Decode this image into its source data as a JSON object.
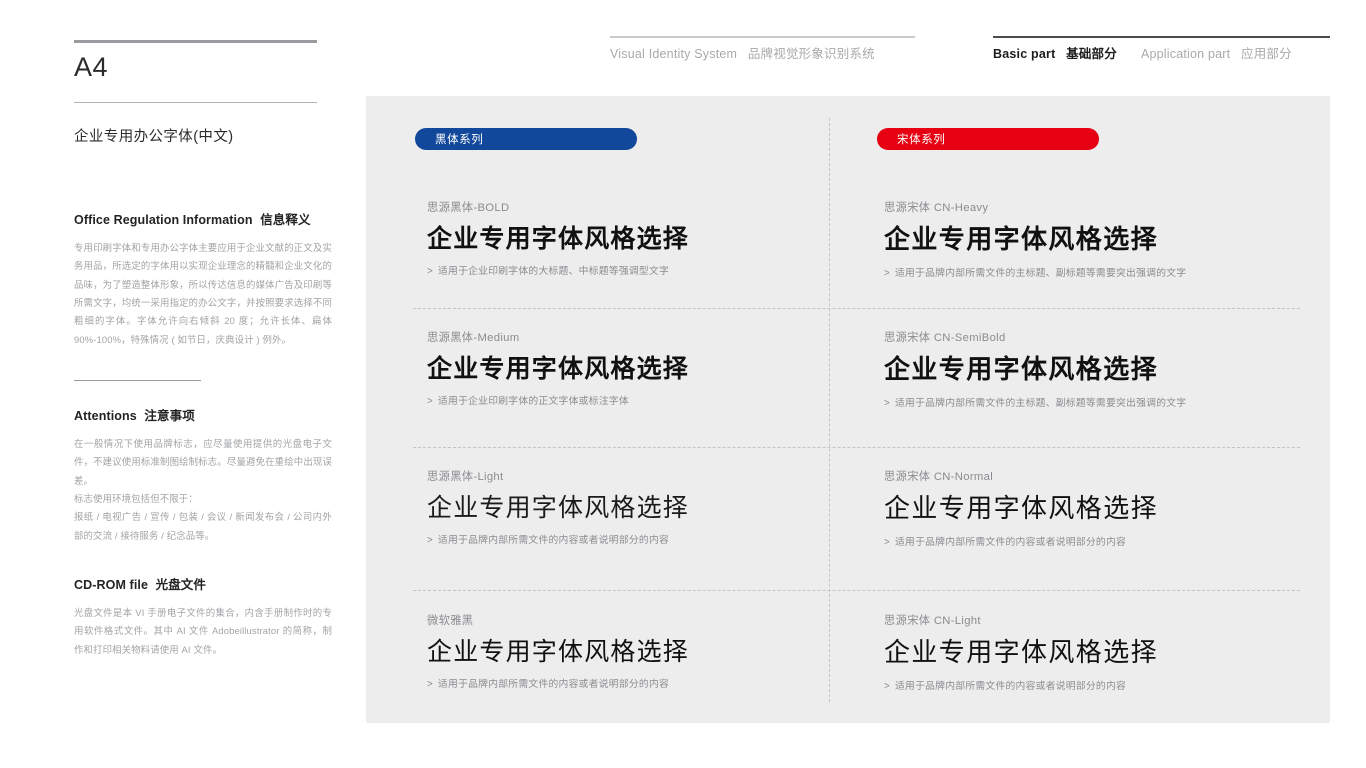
{
  "header": {
    "nav_left": {
      "en": "Visual Identity System",
      "cn": "品牌视觉形象识别系统"
    },
    "nav_right_active": {
      "en": "Basic part",
      "cn": "基础部分"
    },
    "nav_right_inactive": {
      "en": "Application part",
      "cn": "应用部分"
    },
    "active_accent": "#1c1c1c",
    "inactive_accent": "#a8a9ac"
  },
  "sidebar": {
    "page_code": "A4",
    "page_subtitle": "企业专用办公字体(中文)",
    "blocks": [
      {
        "head_en": "Office Regulation Information",
        "head_cn": "信息释义",
        "body": "专用印刷字体和专用办公字体主要应用于企业文献的正文及实务用品，所选定的字体用以实现企业理念的精髓和企业文化的品味，为了塑造整体形象，所以传达信息的媒体广告及印刷等所需文字，均统一采用指定的办公文字，并按照要求选择不同粗细的字体。字体允许向右倾斜 20 度；允许长体、扁体 90%-100%，特殊情况 ( 如节日，庆典设计 ) 例外。"
      },
      {
        "head_en": "Attentions",
        "head_cn": "注意事项",
        "body_1": "在一般情况下使用品牌标志，应尽量使用提供的光盘电子文件，不建议使用标准制图绘制标志。尽量避免在重绘中出现误差。",
        "body_2": "标志使用环境包括但不限于：",
        "body_3": "报纸 / 电视广告 / 宣传 / 包装 / 会议 / 新闻发布会 / 公司内外部的交流 / 接待服务 / 纪念品等。"
      },
      {
        "head_en": "CD-ROM file",
        "head_cn": "光盘文件",
        "body": "光盘文件是本 VI 手册电子文件的集合，内含手册制作时的专用软件格式文件。其中 AI 文件 Adobeillustrator 的简称，制作和打印相关物料请使用 AI 文件。"
      }
    ]
  },
  "panel": {
    "background": "#ededee",
    "pills": [
      {
        "label": "黑体系列",
        "color": "#12489b"
      },
      {
        "label": "宋体系列",
        "color": "#e60012"
      }
    ],
    "left_column": [
      {
        "name": "思源黑体-BOLD",
        "sample": "企业专用字体风格选择",
        "note": "适用于企业印刷字体的大标题、中标题等强调型文字",
        "chevron": ">"
      },
      {
        "name": "思源黑体-Medium",
        "sample": "企业专用字体风格选择",
        "note": "适用于企业印刷字体的正文字体或标注字体",
        "chevron": ">"
      },
      {
        "name": "思源黑体-Light",
        "sample": "企业专用字体风格选择",
        "note": "适用于品牌内部所需文件的内容或者说明部分的内容",
        "chevron": ">"
      },
      {
        "name": "微软雅黑",
        "sample": "企业专用字体风格选择",
        "note": "适用于品牌内部所需文件的内容或者说明部分的内容",
        "chevron": ">"
      }
    ],
    "right_column": [
      {
        "name": "思源宋体 CN-Heavy",
        "sample": "企业专用字体风格选择",
        "note": "适用于品牌内部所需文件的主标题、副标题等需要突出强调的文字",
        "chevron": ">"
      },
      {
        "name": "思源宋体 CN-SemiBold",
        "sample": "企业专用字体风格选择",
        "note": "适用于品牌内部所需文件的主标题、副标题等需要突出强调的文字",
        "chevron": ">"
      },
      {
        "name": "思源宋体 CN-Normal",
        "sample": "企业专用字体风格选择",
        "note": "适用于品牌内部所需文件的内容或者说明部分的内容",
        "chevron": ">"
      },
      {
        "name": "思源宋体 CN-Light",
        "sample": "企业专用字体风格选择",
        "note": "适用于品牌内部所需文件的内容或者说明部分的内容",
        "chevron": ">"
      }
    ]
  }
}
